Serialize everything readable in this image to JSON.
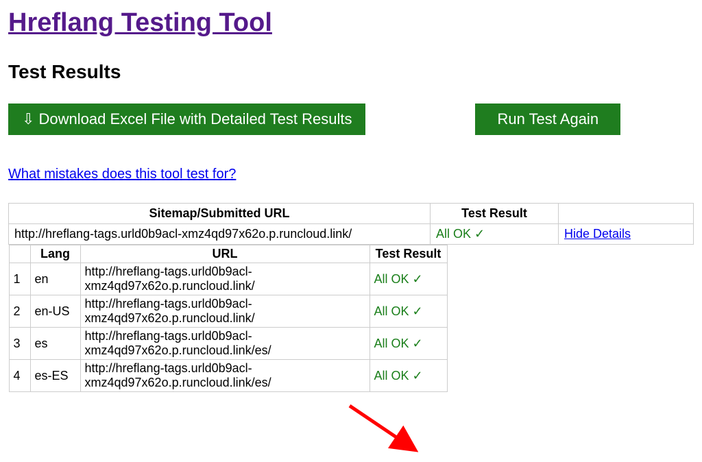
{
  "page": {
    "title": "Hreflang Testing Tool",
    "results_heading": "Test Results"
  },
  "buttons": {
    "download_label": "⇩ Download Excel File with Detailed Test Results",
    "run_again_label": "Run Test Again"
  },
  "links": {
    "mistakes_label": "What mistakes does this tool test for?",
    "hide_details_label": "Hide Details"
  },
  "table": {
    "col_sitemap": "Sitemap/Submitted URL",
    "col_test_result": "Test Result",
    "main_url": "http://hreflang-tags.urld0b9acl-xmz4qd97x62o.p.runcloud.link/",
    "main_result": "All OK ✓"
  },
  "details": {
    "col_lang": "Lang",
    "col_url": "URL",
    "col_test_result": "Test Result",
    "rows": [
      {
        "n": "1",
        "lang": "en",
        "url": "http://hreflang-tags.urld0b9acl-xmz4qd97x62o.p.runcloud.link/",
        "result": "All OK ✓"
      },
      {
        "n": "2",
        "lang": "en-US",
        "url": "http://hreflang-tags.urld0b9acl-xmz4qd97x62o.p.runcloud.link/",
        "result": "All OK ✓"
      },
      {
        "n": "3",
        "lang": "es",
        "url": "http://hreflang-tags.urld0b9acl-xmz4qd97x62o.p.runcloud.link/es/",
        "result": "All OK ✓"
      },
      {
        "n": "4",
        "lang": "es-ES",
        "url": "http://hreflang-tags.urld0b9acl-xmz4qd97x62o.p.runcloud.link/es/",
        "result": "All OK ✓"
      }
    ]
  }
}
